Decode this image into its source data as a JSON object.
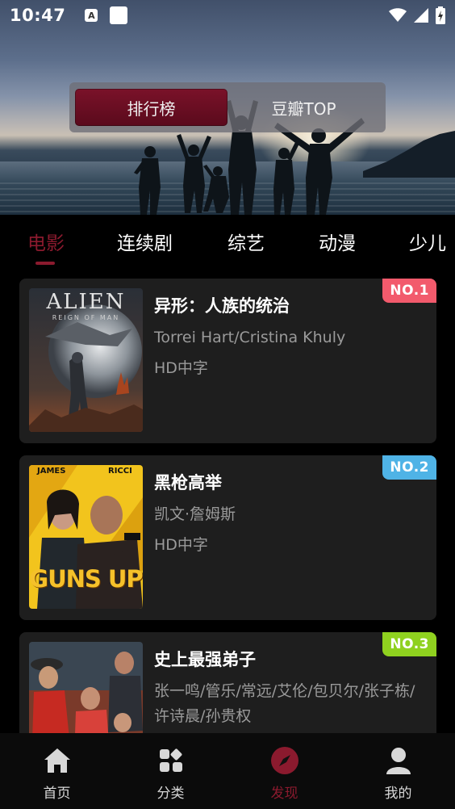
{
  "status_bar": {
    "time": "10:47",
    "badge_letter": "A"
  },
  "segment": {
    "items": [
      "排行榜",
      "豆瓣TOP"
    ],
    "active_index": 0
  },
  "tabs": {
    "items": [
      "电影",
      "连续剧",
      "综艺",
      "动漫",
      "少儿"
    ],
    "active_index": 0
  },
  "cards": [
    {
      "title": "异形：人族的统治",
      "cast": "Torrei Hart/Cristina Khuly",
      "quality": "HD中字",
      "rank": "NO.1",
      "rank_color": "#f25a6c",
      "poster_title": "ALIEN",
      "poster_subtitle": "REIGN OF MAN"
    },
    {
      "title": "黑枪高举",
      "cast": "凯文·詹姆斯",
      "quality": "HD中字",
      "rank": "NO.2",
      "rank_color": "#4fb3e6",
      "poster_title": "GUNS UP",
      "poster_names": [
        "JAMES",
        "RICCI"
      ]
    },
    {
      "title": "史上最强弟子",
      "cast": "张一鸣/管乐/常远/艾伦/包贝尔/张子栋/许诗晨/孙贵权",
      "quality": "",
      "rank": "NO.3",
      "rank_color": "#8fd11f"
    }
  ],
  "bottom_nav": {
    "items": [
      {
        "label": "首页",
        "icon": "home-icon"
      },
      {
        "label": "分类",
        "icon": "category-icon"
      },
      {
        "label": "发现",
        "icon": "compass-icon"
      },
      {
        "label": "我的",
        "icon": "user-icon"
      }
    ],
    "active_index": 2
  },
  "colors": {
    "accent": "#8b1a2e",
    "card_bg": "#1e1e1e",
    "background": "#000000"
  }
}
